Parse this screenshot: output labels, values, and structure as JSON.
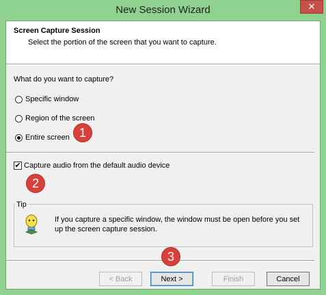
{
  "window": {
    "title": "New Session Wizard",
    "close_label": "✕"
  },
  "header": {
    "title": "Screen Capture Session",
    "subtitle": "Select the portion of the screen that you want to capture."
  },
  "capture": {
    "question": "What do you want to capture?",
    "options": [
      {
        "label": "Specific window",
        "checked": false
      },
      {
        "label": "Region of the screen",
        "checked": false
      },
      {
        "label": "Entire screen",
        "checked": true
      }
    ]
  },
  "audio": {
    "label": "Capture audio from the default audio device",
    "checked": true,
    "check_mark": "✔"
  },
  "tip": {
    "label": "Tip",
    "text": "If you capture a specific window, the window must be open before you set up the screen capture session."
  },
  "buttons": {
    "back": "< Back",
    "next": "Next >",
    "finish": "Finish",
    "cancel": "Cancel"
  },
  "badges": [
    "1",
    "2",
    "3"
  ],
  "colors": {
    "frame": "#8fd18f",
    "badge": "#d8413b",
    "close": "#c7504a"
  }
}
